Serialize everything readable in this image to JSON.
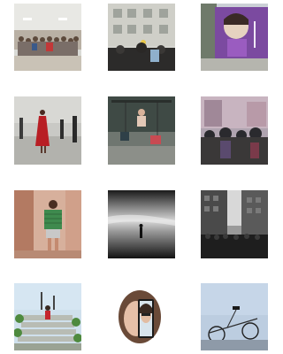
{
  "gallery": {
    "photos": [
      {
        "id": 1,
        "subject": "group-gathering"
      },
      {
        "id": 2,
        "subject": "building-protest"
      },
      {
        "id": 3,
        "subject": "mural-wall"
      },
      {
        "id": 4,
        "subject": "street-red-dress"
      },
      {
        "id": 5,
        "subject": "playground-swings"
      },
      {
        "id": 6,
        "subject": "street-crowd"
      },
      {
        "id": 7,
        "subject": "alley-green-shirt"
      },
      {
        "id": 8,
        "subject": "misty-figure"
      },
      {
        "id": 9,
        "subject": "city-avenue-crowd"
      },
      {
        "id": 10,
        "subject": "stairs-flowers"
      },
      {
        "id": 11,
        "subject": "face-phone-selfie"
      },
      {
        "id": 12,
        "subject": "bicycle-sky"
      }
    ]
  }
}
